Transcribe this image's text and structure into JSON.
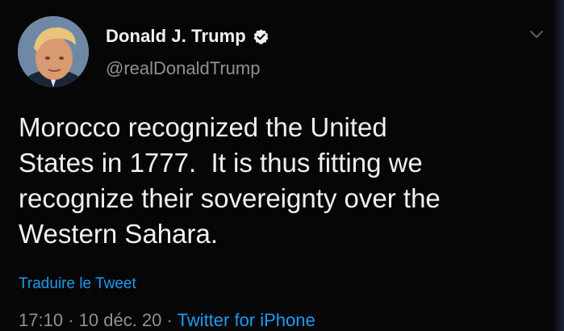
{
  "tweet": {
    "display_name": "Donald J. Trump",
    "handle": "@realDonaldTrump",
    "text": "Morocco recognized the United\nStates in 1777.  It is thus fitting we\nrecognize their sovereignty over the\nWestern Sahara.",
    "translate_label": "Traduire le Tweet",
    "time": "17:10",
    "separator": "·",
    "date": "10 déc. 20",
    "source": "Twitter for iPhone"
  },
  "icons": {
    "verified": "verified-badge-icon",
    "caret": "chevron-down-icon"
  },
  "colors": {
    "background": "#060606",
    "text": "#f0f0f0",
    "secondary": "#8d9296",
    "link": "#1d9bf0"
  }
}
